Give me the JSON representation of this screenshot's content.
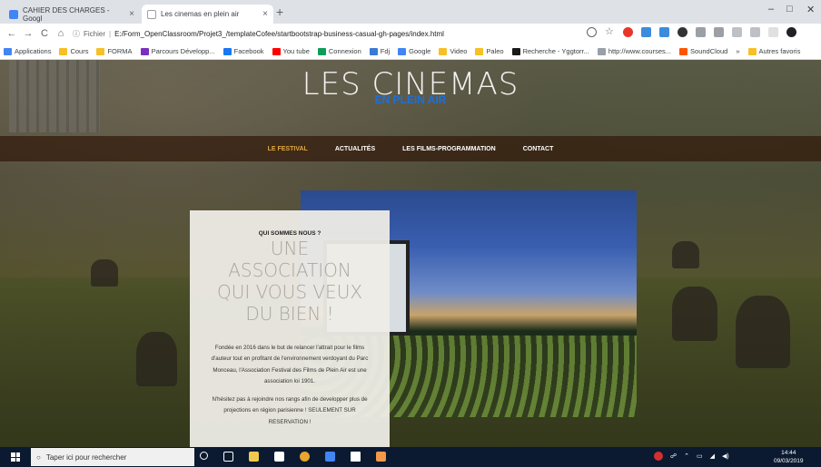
{
  "browser": {
    "tabs": [
      {
        "title": "CAHIER DES CHARGES - Googl",
        "active": false
      },
      {
        "title": "Les cinemas en plein air",
        "active": true
      }
    ],
    "new_tab": "+",
    "close": "×",
    "window_controls": {
      "minimize": "–",
      "maximize": "□",
      "close": "✕"
    },
    "nav": {
      "back": "←",
      "forward": "→",
      "reload": "C",
      "home": "⌂"
    },
    "address": {
      "scheme_label": "Fichier",
      "url": "E:/Form_OpenClassroom/Projet3_/templateCofee/startbootstrap-business-casual-gh-pages/index.html"
    }
  },
  "bookmarks": [
    {
      "label": "Applications",
      "color": "#4285f4"
    },
    {
      "label": "Cours",
      "color": "#f6c026"
    },
    {
      "label": "FORMA",
      "color": "#f6c026"
    },
    {
      "label": "Parcours Développ...",
      "color": "#7b2fbf"
    },
    {
      "label": "Facebook",
      "color": "#1877f2"
    },
    {
      "label": "You tube",
      "color": "#ff0000"
    },
    {
      "label": "Connexion",
      "color": "#0f9d58"
    },
    {
      "label": "Fdj",
      "color": "#3a7bd5"
    },
    {
      "label": "Google",
      "color": "#4285f4"
    },
    {
      "label": "Video",
      "color": "#f6c026"
    },
    {
      "label": "Paleo",
      "color": "#f6c026"
    },
    {
      "label": "Recherche - Yggtorr...",
      "color": "#1a1a1a"
    },
    {
      "label": "http://www.courses...",
      "color": "#9aa0a6"
    },
    {
      "label": "SoundCloud",
      "color": "#ff5500"
    },
    {
      "label": "»",
      "color": ""
    },
    {
      "label": "Autres favoris",
      "color": "#f6c026"
    }
  ],
  "site": {
    "title": "LES CINEMAS",
    "subtitle": "EN PLEIN AIR",
    "nav": [
      {
        "label": "LE FESTIVAL",
        "active": true
      },
      {
        "label": "ACTUALITÉS",
        "active": false
      },
      {
        "label": "LES FILMS-PROGRAMMATION",
        "active": false
      },
      {
        "label": "CONTACT",
        "active": false
      }
    ],
    "card": {
      "kicker": "QUI SOMMES NOUS ?",
      "heading_lines": [
        "UNE",
        "ASSOCIATION",
        "QUI VOUS VEUX",
        "DU BIEN !"
      ],
      "paragraph1": "Fondée en 2016 dans le but de relancer l'attrait pour le films d'auteur tout en profitant de l'environnement verdoyant du Parc Monceau, l'Association Festival des Films de Plein Air est une association loi 1901.",
      "paragraph2": "N'hésitez pas à rejoindre nos rangs afin de developper plus de projections en région parisienne ! SEULEMENT SUR RESERVATION !"
    }
  },
  "taskbar": {
    "search_placeholder": "Taper ici pour rechercher",
    "time": "14:44",
    "date": "09/03/2019"
  }
}
